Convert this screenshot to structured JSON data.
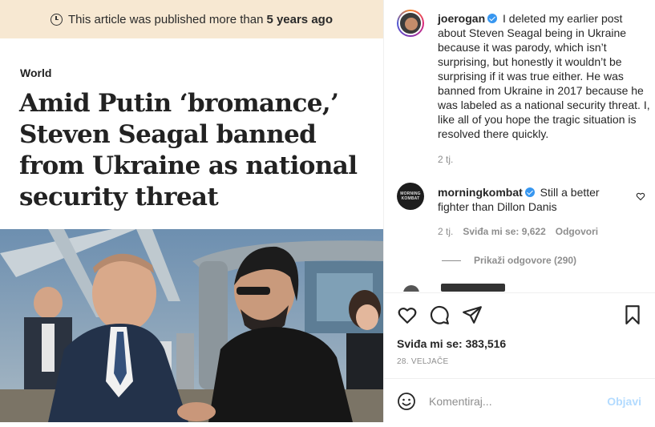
{
  "article": {
    "notice_prefix": "This article was published more than",
    "notice_bold": "5 years ago",
    "kicker": "World",
    "headline": "Amid Putin ‘bromance,’ Steven Seagal banned from Ukraine as national security threat"
  },
  "caption": {
    "username": "joerogan",
    "text": "I deleted my earlier post about Steven Seagal being in Ukraine because it was parody, which isn’t surprising, but honestly it wouldn’t be surprising if it was true either. He was banned from Ukraine in 2017 because he was labeled as a national security threat. I, like all of you hope the tragic situation is resolved there quickly.",
    "time": "2 tj."
  },
  "comments": [
    {
      "username": "morningkombat",
      "text": "Still a better fighter than Dillon Danis",
      "time": "2 tj.",
      "likes": "Sviđa mi se: 9,622",
      "reply_label": "Odgovori",
      "view_replies": "Prikaži odgovore (290)",
      "avatar_text": "MORNING KOMBAT"
    }
  ],
  "post": {
    "likes": "Sviđa mi se: 383,516",
    "date": "28. VELJAČE"
  },
  "comment_box": {
    "placeholder": "Komentiraj...",
    "post_label": "Objavi"
  },
  "icons": {
    "clock": "clock-icon",
    "verified": "verified-badge-icon",
    "like": "heart-icon",
    "comment": "comment-bubble-icon",
    "share": "paper-plane-icon",
    "save": "bookmark-icon",
    "emoji": "smiley-icon"
  },
  "colors": {
    "verified": "#3897f0",
    "notice_bg": "#f7e8d2",
    "muted_text": "#8e8e8e",
    "post_button_disabled": "#b3dbff"
  }
}
